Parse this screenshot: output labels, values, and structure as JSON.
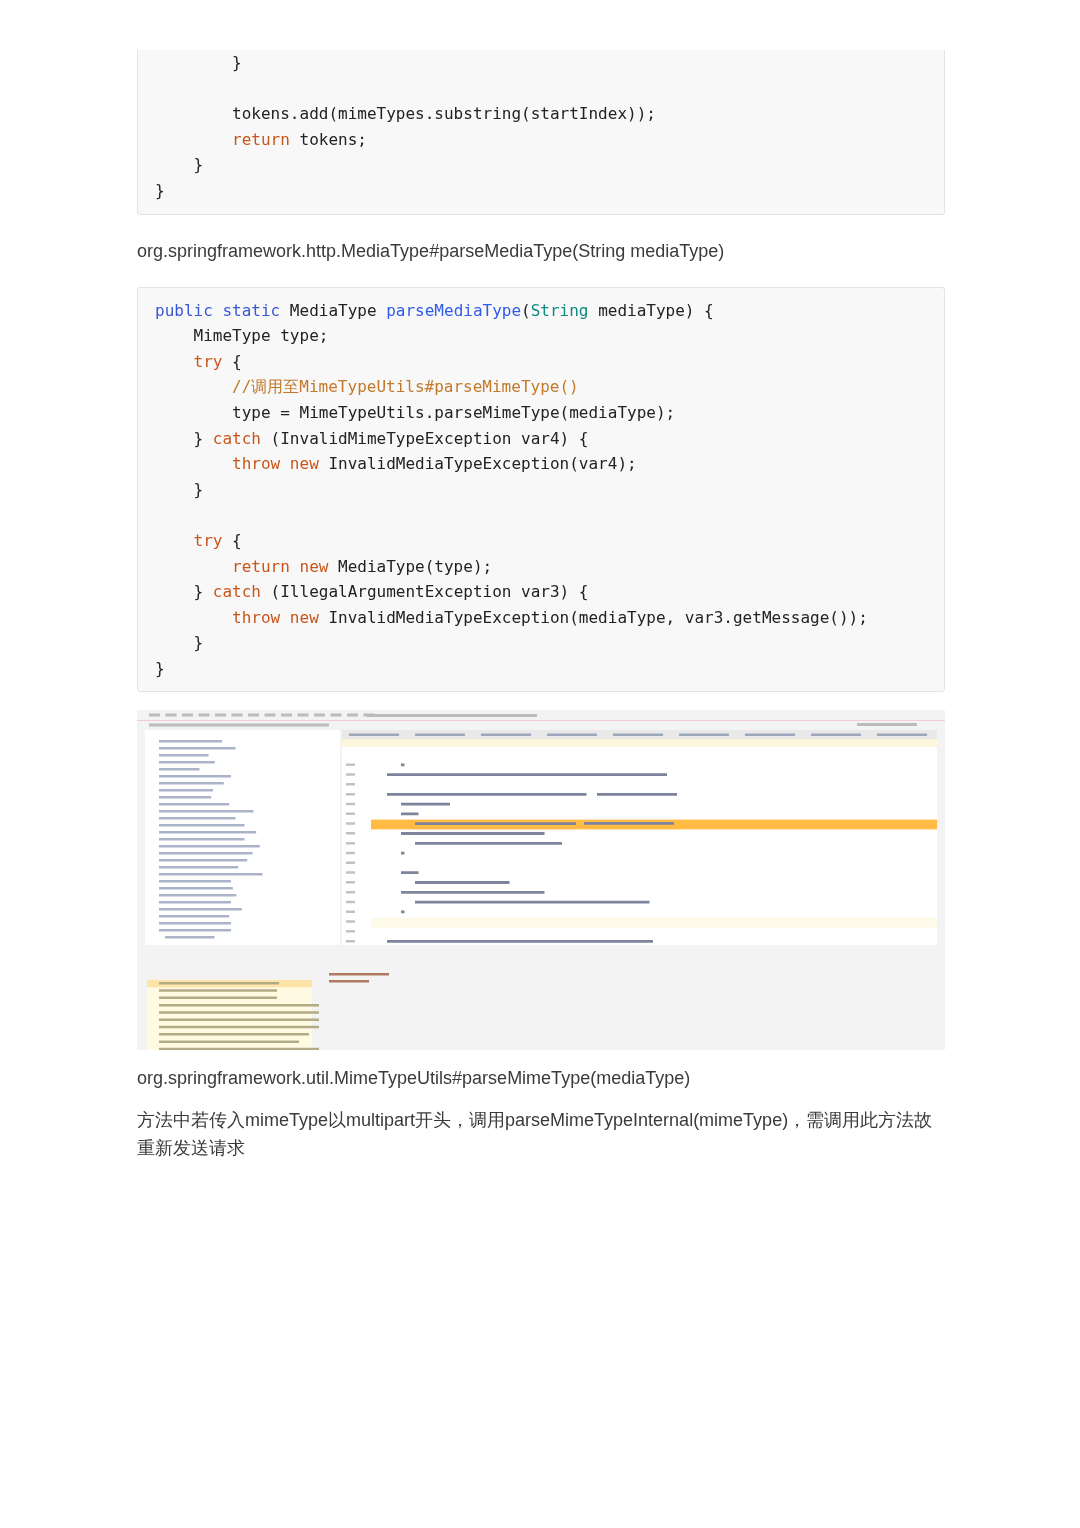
{
  "code_block_1": {
    "lines": [
      {
        "kind": "code",
        "segments": [
          {
            "text": "        }",
            "kind": "plain"
          }
        ]
      },
      {
        "kind": "blank"
      },
      {
        "kind": "code",
        "segments": [
          {
            "text": "        tokens.add(mimeTypes.substring(startIndex));",
            "kind": "plain"
          }
        ]
      },
      {
        "kind": "code",
        "segments": [
          {
            "text": "        return",
            "kind": "control"
          },
          {
            "text": " tokens;",
            "kind": "plain"
          }
        ]
      },
      {
        "kind": "code",
        "segments": [
          {
            "text": "    }",
            "kind": "plain"
          }
        ]
      },
      {
        "kind": "code",
        "segments": [
          {
            "text": "}",
            "kind": "plain"
          }
        ]
      }
    ]
  },
  "caption_1": "org.springframework.http.MediaType#parseMediaType(String mediaType)",
  "code_block_2": {
    "lines": [
      {
        "kind": "code",
        "segments": [
          {
            "text": "public static",
            "kind": "keyword"
          },
          {
            "text": " MediaType ",
            "kind": "plain"
          },
          {
            "text": "parseMediaType",
            "kind": "function"
          },
          {
            "text": "(",
            "kind": "plain"
          },
          {
            "text": "String",
            "kind": "type"
          },
          {
            "text": " mediaType) {",
            "kind": "plain"
          }
        ]
      },
      {
        "kind": "code",
        "segments": [
          {
            "text": "    MimeType type;",
            "kind": "plain"
          }
        ]
      },
      {
        "kind": "code",
        "segments": [
          {
            "text": "    try",
            "kind": "control"
          },
          {
            "text": " {",
            "kind": "plain"
          }
        ]
      },
      {
        "kind": "code",
        "segments": [
          {
            "text": "        //调用至MimeTypeUtils#parseMimeType()",
            "kind": "comment"
          }
        ]
      },
      {
        "kind": "code",
        "segments": [
          {
            "text": "        type = MimeTypeUtils.parseMimeType(mediaType);",
            "kind": "plain"
          }
        ]
      },
      {
        "kind": "code",
        "segments": [
          {
            "text": "    } ",
            "kind": "plain"
          },
          {
            "text": "catch",
            "kind": "control"
          },
          {
            "text": " (InvalidMimeTypeException var4) {",
            "kind": "plain"
          }
        ]
      },
      {
        "kind": "code",
        "segments": [
          {
            "text": "        throw new",
            "kind": "control"
          },
          {
            "text": " InvalidMediaTypeException(var4);",
            "kind": "plain"
          }
        ]
      },
      {
        "kind": "code",
        "segments": [
          {
            "text": "    }",
            "kind": "plain"
          }
        ]
      },
      {
        "kind": "blank"
      },
      {
        "kind": "code",
        "segments": [
          {
            "text": "    try",
            "kind": "control"
          },
          {
            "text": " {",
            "kind": "plain"
          }
        ]
      },
      {
        "kind": "code",
        "segments": [
          {
            "text": "        return new",
            "kind": "control"
          },
          {
            "text": " MediaType(type);",
            "kind": "plain"
          }
        ]
      },
      {
        "kind": "code",
        "segments": [
          {
            "text": "    } ",
            "kind": "plain"
          },
          {
            "text": "catch",
            "kind": "control"
          },
          {
            "text": " (IllegalArgumentException var3) {",
            "kind": "plain"
          }
        ]
      },
      {
        "kind": "code",
        "segments": [
          {
            "text": "        throw new",
            "kind": "control"
          },
          {
            "text": " InvalidMediaTypeException(mediaType, var3.getMessage());",
            "kind": "plain"
          }
        ]
      },
      {
        "kind": "code",
        "segments": [
          {
            "text": "    }",
            "kind": "plain"
          }
        ]
      },
      {
        "kind": "code",
        "segments": [
          {
            "text": "}",
            "kind": "plain"
          }
        ]
      }
    ]
  },
  "caption_2": "org.springframework.util.MimeTypeUtils#parseMimeType(mediaType)",
  "paragraph": "方法中若传入mimeType以multipart开头，调用parseMimeTypeInternal(mimeType)，需调用此方法故重新发送请求"
}
